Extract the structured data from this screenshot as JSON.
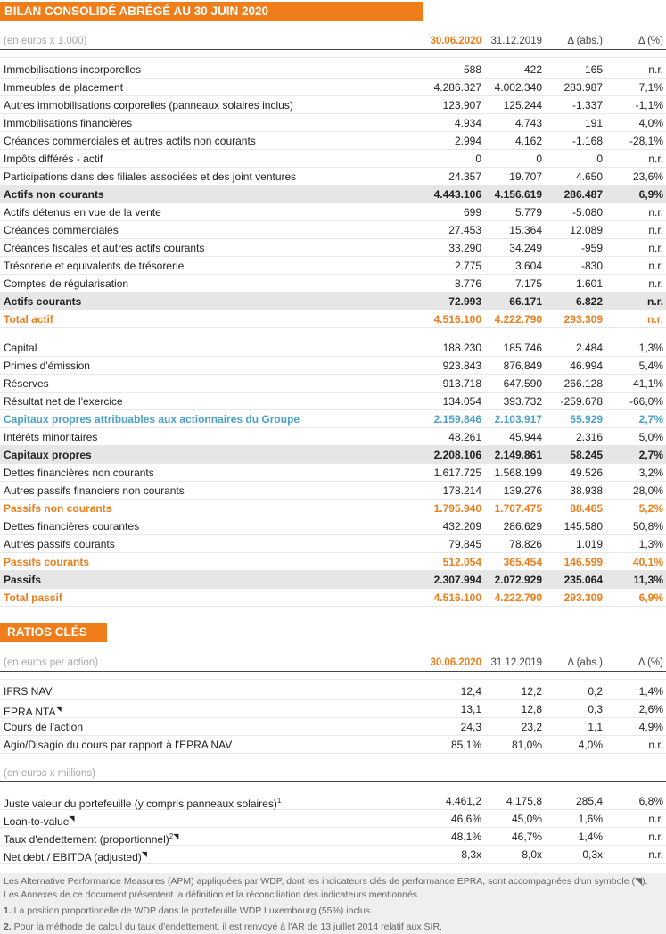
{
  "balance": {
    "title": "BILAN CONSOLIDÉ ABRÉGÉ AU 30 JUIN 2020",
    "header": {
      "unit": "(en euros x 1.000)",
      "col1": "30.06.2020",
      "col2": "31.12.2019",
      "col3": "Δ (abs.)",
      "col4": "Δ (%)"
    },
    "rows": [
      {
        "label": "Immobilisations incorporelles",
        "v1": "588",
        "v2": "422",
        "v3": "165",
        "v4": "n.r."
      },
      {
        "label": "Immeubles de placement",
        "v1": "4.286.327",
        "v2": "4.002.340",
        "v3": "283.987",
        "v4": "7,1%"
      },
      {
        "label": "Autres immobilisations corporelles (panneaux solaires inclus)",
        "v1": "123.907",
        "v2": "125.244",
        "v3": "-1.337",
        "v4": "-1,1%"
      },
      {
        "label": "Immobilisations financières",
        "v1": "4.934",
        "v2": "4.743",
        "v3": "191",
        "v4": "4,0%"
      },
      {
        "label": "Créances commerciales et autres actifs non courants",
        "v1": "2.994",
        "v2": "4.162",
        "v3": "-1.168",
        "v4": "-28,1%"
      },
      {
        "label": "Impôts différés - actif",
        "v1": "0",
        "v2": "0",
        "v3": "0",
        "v4": "n.r."
      },
      {
        "label": "Participations dans des filiales associées et des joint ventures",
        "v1": "24.357",
        "v2": "19.707",
        "v3": "4.650",
        "v4": "23,6%"
      },
      {
        "label": "Actifs non courants",
        "v1": "4.443.106",
        "v2": "4.156.619",
        "v3": "286.487",
        "v4": "6,9%"
      },
      {
        "label": "Actifs détenus en vue de la vente",
        "v1": "699",
        "v2": "5.779",
        "v3": "-5.080",
        "v4": "n.r."
      },
      {
        "label": "Créances commerciales",
        "v1": "27.453",
        "v2": "15.364",
        "v3": "12.089",
        "v4": "n.r."
      },
      {
        "label": "Créances fiscales et autres actifs courants",
        "v1": "33.290",
        "v2": "34.249",
        "v3": "-959",
        "v4": "n.r."
      },
      {
        "label": "Trésorerie et equivalents de trésorerie",
        "v1": "2.775",
        "v2": "3.604",
        "v3": "-830",
        "v4": "n.r."
      },
      {
        "label": "Comptes de régularisation",
        "v1": "8.776",
        "v2": "7.175",
        "v3": "1.601",
        "v4": "n.r."
      },
      {
        "label": "Actifs courants",
        "v1": "72.993",
        "v2": "66.171",
        "v3": "6.822",
        "v4": "n.r."
      },
      {
        "label": "Total actif",
        "v1": "4.516.100",
        "v2": "4.222.790",
        "v3": "293.309",
        "v4": "n.r."
      },
      {
        "label": "Capital",
        "v1": "188.230",
        "v2": "185.746",
        "v3": "2.484",
        "v4": "1,3%"
      },
      {
        "label": "Primes d'émission",
        "v1": "923.843",
        "v2": "876.849",
        "v3": "46.994",
        "v4": "5,4%"
      },
      {
        "label": "Réserves",
        "v1": "913.718",
        "v2": "647.590",
        "v3": "266.128",
        "v4": "41,1%"
      },
      {
        "label": "Résultat net de l'exercice",
        "v1": "134.054",
        "v2": "393.732",
        "v3": "-259.678",
        "v4": "-66,0%"
      },
      {
        "label": "Capitaux propres attribuables aux actionnaires du Groupe",
        "v1": "2.159.846",
        "v2": "2.103.917",
        "v3": "55.929",
        "v4": "2,7%"
      },
      {
        "label": "Intérêts minoritaires",
        "v1": "48.261",
        "v2": "45.944",
        "v3": "2.316",
        "v4": "5,0%"
      },
      {
        "label": "Capitaux propres",
        "v1": "2.208.106",
        "v2": "2.149.861",
        "v3": "58.245",
        "v4": "2,7%"
      },
      {
        "label": "Dettes financières non courants",
        "v1": "1.617.725",
        "v2": "1.568.199",
        "v3": "49.526",
        "v4": "3,2%"
      },
      {
        "label": "Autres passifs financiers non courants",
        "v1": "178.214",
        "v2": "139.276",
        "v3": "38.938",
        "v4": "28,0%"
      },
      {
        "label": "Passifs non courants",
        "v1": "1.795.940",
        "v2": "1.707.475",
        "v3": "88.465",
        "v4": "5,2%"
      },
      {
        "label": "Dettes financières courantes",
        "v1": "432.209",
        "v2": "286.629",
        "v3": "145.580",
        "v4": "50,8%"
      },
      {
        "label": "Autres passifs courants",
        "v1": "79.845",
        "v2": "78.826",
        "v3": "1.019",
        "v4": "1,3%"
      },
      {
        "label": "Passifs courants",
        "v1": "512.054",
        "v2": "365.454",
        "v3": "146.599",
        "v4": "40,1%"
      },
      {
        "label": "Passifs",
        "v1": "2.307.994",
        "v2": "2.072.929",
        "v3": "235.064",
        "v4": "11,3%"
      },
      {
        "label": "Total passif",
        "v1": "4.516.100",
        "v2": "4.222.790",
        "v3": "293.309",
        "v4": "6,9%"
      }
    ]
  },
  "ratios": {
    "title": "RATIOS CLÉS",
    "header": {
      "unit": "(en euros per action)",
      "col1": "30.06.2020",
      "col2": "31.12.2019",
      "col3": "Δ (abs.)",
      "col4": "Δ (%)"
    },
    "rows": [
      {
        "label": "IFRS NAV",
        "v1": "12,4",
        "v2": "12,2",
        "v3": "0,2",
        "v4": "1,4%"
      },
      {
        "label": "EPRA NTA",
        "v1": "13,1",
        "v2": "12,8",
        "v3": "0,3",
        "v4": "2,6%"
      },
      {
        "label": "Cours de l'action",
        "v1": "24,3",
        "v2": "23,2",
        "v3": "1,1",
        "v4": "4,9%"
      },
      {
        "label": "Agio/Disagio du cours par rapport à l'EPRA NAV",
        "v1": "85,1%",
        "v2": "81,0%",
        "v3": "4,0%",
        "v4": "n.r."
      }
    ],
    "unit2": "(en euros x millions)",
    "rows2": [
      {
        "label": "Juste valeur du portefeuille (y compris panneaux solaires)",
        "v1": "4.461,2",
        "v2": "4.175,8",
        "v3": "285,4",
        "v4": "6,8%"
      },
      {
        "label": "Loan-to-value",
        "v1": "46,6%",
        "v2": "45,0%",
        "v3": "1,6%",
        "v4": "n.r."
      },
      {
        "label": "Taux d'endettement (proportionnel)",
        "v1": "48,1%",
        "v2": "46,7%",
        "v3": "1,4%",
        "v4": "n.r."
      },
      {
        "label": "Net debt / EBITDA (adjusted)",
        "v1": "8,3x",
        "v2": "8,0x",
        "v3": "0,3x",
        "v4": "n.r."
      }
    ],
    "marks": {
      "sup1": "1",
      "sup2": "2",
      "apm": "◥"
    }
  },
  "notes": {
    "apm": "Les Alternative Performance Measures (APM) appliquées par WDP, dont les indicateurs clés de performance EPRA, sont accompagnées d'un symbole (◥). Les Annexes de ce document présentent la définition et la réconciliation des indicateurs mentionnés.",
    "n1_num": "1.",
    "n1": " La position proportionelle de WDP dans le portefeuille WDP Luxembourg (55%) inclus.",
    "n2_num": "2.",
    "n2": " Pour la méthode de calcul du taux d'endettement, il est renvoyé à l'AR de 13 juillet 2014 relatif aux SIR."
  },
  "colors": {
    "orange": "#ee7d1a",
    "blue": "#4aa2c6",
    "subtotal_bg": "#e6e6e6"
  }
}
